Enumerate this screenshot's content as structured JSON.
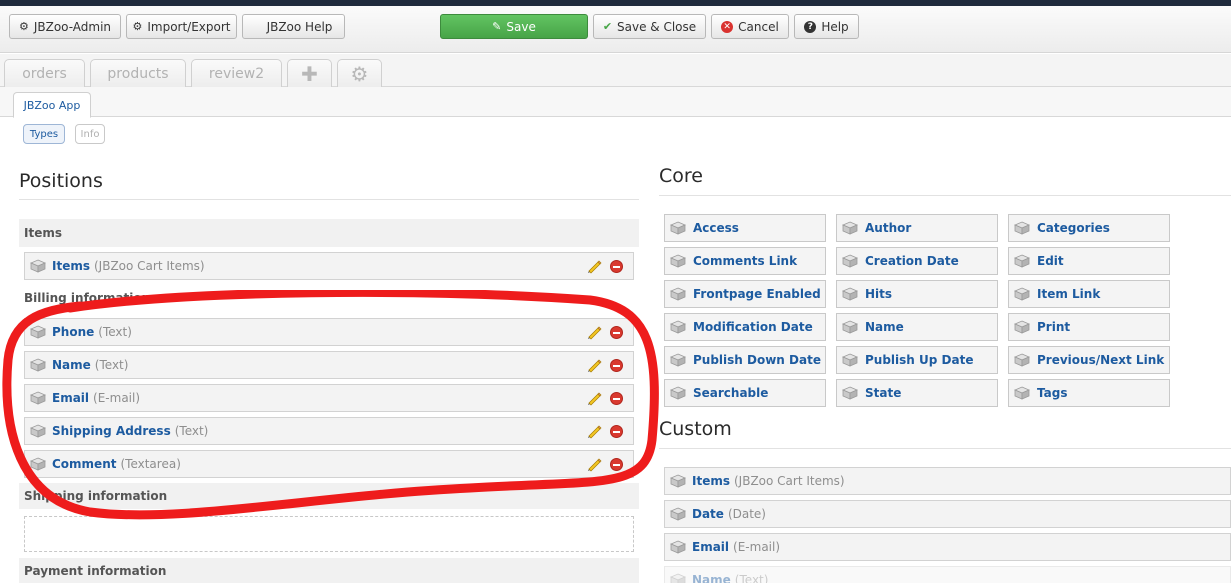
{
  "toolbar": {
    "admin": "JBZoo-Admin",
    "import_export": "Import/Export",
    "help_jbzoo": "JBZoo Help",
    "save": "Save",
    "save_close": "Save & Close",
    "cancel": "Cancel",
    "help": "Help"
  },
  "app_tabs": [
    "orders",
    "products",
    "review2"
  ],
  "subtab": "JBZoo App",
  "pills": {
    "types": "Types",
    "info": "Info"
  },
  "positions": {
    "title": "Positions",
    "groups": [
      {
        "label": "Items",
        "rows": [
          {
            "name": "Items",
            "type": "(JBZoo Cart Items)"
          }
        ]
      },
      {
        "label": "Billing information",
        "rows": [
          {
            "name": "Phone",
            "type": "(Text)"
          },
          {
            "name": "Name",
            "type": "(Text)"
          },
          {
            "name": "Email",
            "type": "(E-mail)"
          },
          {
            "name": "Shipping Address",
            "type": "(Text)"
          },
          {
            "name": "Comment",
            "type": "(Textarea)"
          }
        ]
      },
      {
        "label": "Shipping information",
        "rows": []
      },
      {
        "label": "Payment information",
        "rows": []
      }
    ]
  },
  "core": {
    "title": "Core",
    "elements": [
      "Access",
      "Author",
      "Categories",
      "Comments Link",
      "Creation Date",
      "Edit",
      "Frontpage Enabled",
      "Hits",
      "Item Link",
      "Modification Date",
      "Name",
      "Print",
      "Publish Down Date",
      "Publish Up Date",
      "Previous/Next Link",
      "Searchable",
      "State",
      "Tags"
    ]
  },
  "custom": {
    "title": "Custom",
    "elements": [
      {
        "name": "Items",
        "type": "(JBZoo Cart Items)"
      },
      {
        "name": "Date",
        "type": "(Date)"
      },
      {
        "name": "Email",
        "type": "(E-mail)"
      },
      {
        "name": "Name",
        "type": "(Text)"
      }
    ]
  },
  "colors": {
    "link": "#1d5ba0",
    "save_green": "#47a447",
    "annotation_red": "#ee1c1c"
  }
}
